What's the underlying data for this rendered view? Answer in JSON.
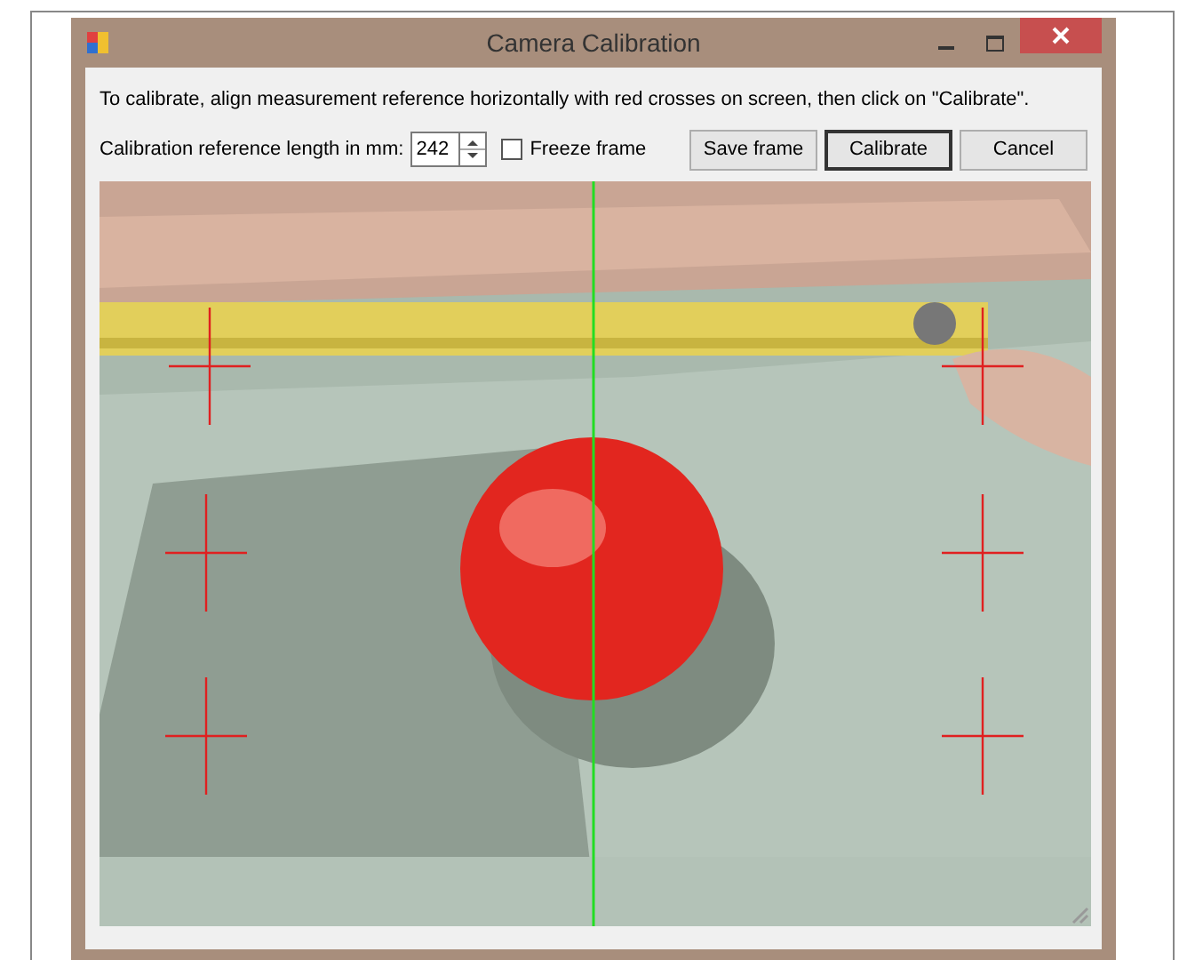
{
  "window": {
    "title": "Camera Calibration"
  },
  "instruction": "To calibrate, align measurement reference horizontally with red crosses on screen, then click on \"Calibrate\".",
  "length_field": {
    "label": "Calibration reference length in mm:",
    "value": "242"
  },
  "freeze_frame": {
    "label": "Freeze frame",
    "checked": false
  },
  "buttons": [
    {
      "label": "Save frame",
      "default": false
    },
    {
      "label": "Calibrate",
      "default": true
    },
    {
      "label": "Cancel",
      "default": false
    }
  ]
}
